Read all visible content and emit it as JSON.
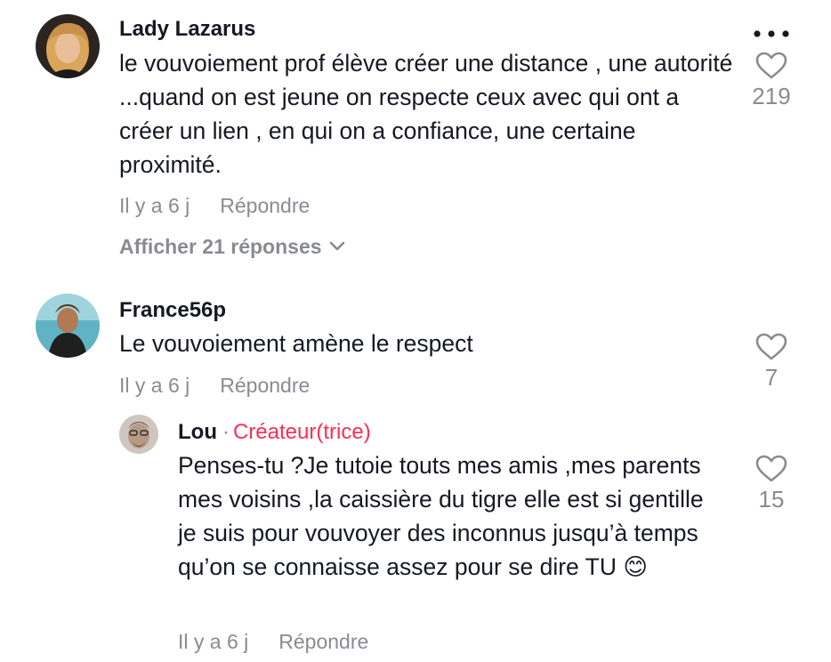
{
  "comments": [
    {
      "username": "Lady Lazarus",
      "text": "le vouvoiement prof élève créer une distance , une autorité ...quand on est jeune on respecte ceux avec qui ont a créer un lien , en qui on a confiance, une certaine proximité.",
      "time": "Il y a 6 j",
      "reply_label": "Répondre",
      "more_replies": "Afficher 21 réponses",
      "likes": "219"
    },
    {
      "username": "France56p",
      "text": "Le vouvoiement amène le respect",
      "time": "Il y a 6 j",
      "reply_label": "Répondre",
      "likes": "7"
    },
    {
      "username": "Lou",
      "separator": "·",
      "badge": "Créateur(trice)",
      "text": "Penses-tu ?Je tutoie touts mes amis ,mes parents mes voisins ,la caissière du tigre elle est si gentille je suis pour vouvoyer des inconnus jusqu’à temps qu’on se connaisse assez pour se dire TU 😊",
      "time": "Il y a 6 j",
      "reply_label": "Répondre",
      "likes": "15"
    }
  ],
  "icons": {
    "more": "more-options-icon",
    "like": "heart-outline-icon",
    "expand": "chevron-down-icon"
  },
  "colors": {
    "creator_badge": "#fe2c55",
    "secondary_text": "#8a8b91",
    "primary_text": "#161823"
  }
}
